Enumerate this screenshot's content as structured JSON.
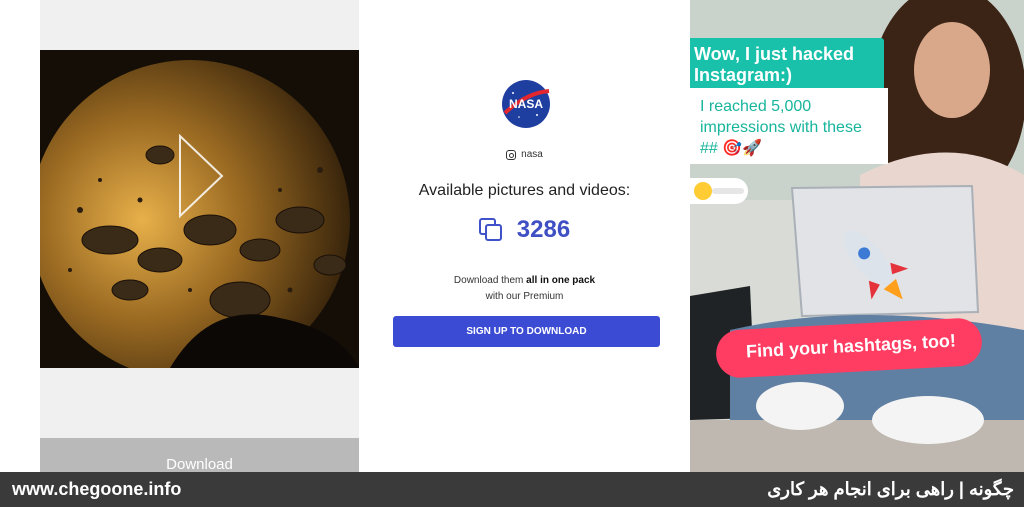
{
  "left_panel": {
    "download_label": "Download"
  },
  "profile": {
    "logo_text": "NASA",
    "handle": "nasa",
    "available_title": "Available pictures and videos:",
    "count": "3286",
    "download_text_prefix": "Download them ",
    "download_text_bold": "all in one pack",
    "download_text_line2": "with our Premium",
    "signup_button": "SIGN UP TO DOWNLOAD",
    "accent_color": "#3b4bd3"
  },
  "ad": {
    "headline": "Wow, I just hacked Instagram:)",
    "subtext": "I reached 5,000 impressions with these ## 🎯🚀",
    "cta": "Find your hashtags, too!"
  },
  "watermark": {
    "url": "www.chegoone.info",
    "tagline": "چگونه | راهی برای انجام هر کاری"
  }
}
